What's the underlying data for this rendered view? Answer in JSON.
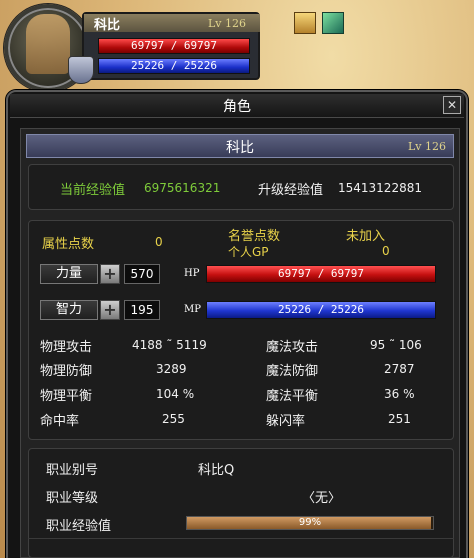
{
  "hud": {
    "name": "科比",
    "level": "Lv 126",
    "hp_text": "69797 / 69797",
    "mp_text": "25226 / 25226"
  },
  "window": {
    "title": "角色",
    "close_glyph": "✕"
  },
  "character": {
    "name": "科比",
    "level": "Lv 126"
  },
  "experience": {
    "current_label": "当前经验值",
    "current_value": "6975616321",
    "next_label": "升级经验值",
    "next_value": "15413122881"
  },
  "attributes": {
    "points_label": "属性点数",
    "points_value": "0",
    "honor_label": "名誉点数",
    "honor_status": "未加入",
    "gp_label": "个人GP",
    "gp_value": "0",
    "strength_label": "力量",
    "strength_value": "570",
    "intellect_label": "智力",
    "intellect_value": "195",
    "hp_label": "HP",
    "mp_label": "MP",
    "hp_text": "69797 / 69797",
    "mp_text": "25226 / 25226",
    "plus_glyph": "+"
  },
  "stats": {
    "phys_atk_label": "物理攻击",
    "phys_atk": "4188 ˜ 5119",
    "mag_atk_label": "魔法攻击",
    "mag_atk": "95 ˜ 106",
    "phys_def_label": "物理防御",
    "phys_def": "3289",
    "mag_def_label": "魔法防御",
    "mag_def": "2787",
    "phys_bal_label": "物理平衡",
    "phys_bal": "104 %",
    "mag_bal_label": "魔法平衡",
    "mag_bal": "36 %",
    "hit_label": "命中率",
    "hit": "255",
    "dodge_label": "躲闪率",
    "dodge": "251"
  },
  "job": {
    "alias_label": "职业别号",
    "alias_value": "科比Q",
    "level_label": "职业等级",
    "level_value": "〈无〉",
    "exp_label": "职业经验值",
    "exp_text": "99%",
    "exp_fraction": 0.99
  },
  "colors": {
    "hp": "#c40f0f",
    "mp": "#1f36d0",
    "label_yellow": "#e8d24a",
    "exp_green": "#7ecb3a"
  }
}
